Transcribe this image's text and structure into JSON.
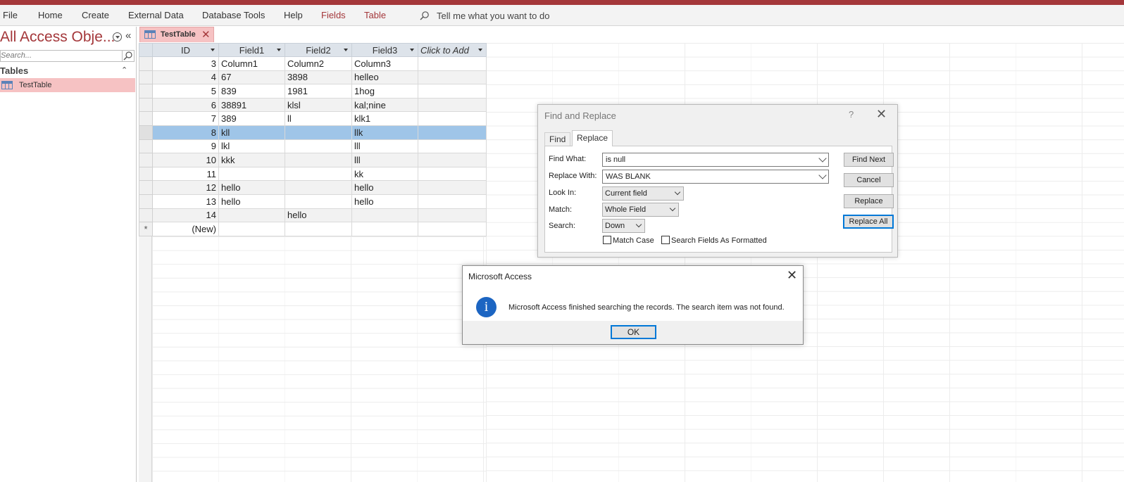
{
  "ribbon": {
    "tabs": [
      "File",
      "Home",
      "Create",
      "External Data",
      "Database Tools",
      "Help"
    ],
    "context_tabs": [
      "Fields",
      "Table"
    ],
    "tell_me": "Tell me what you want to do"
  },
  "nav": {
    "title": "All Access Obje...",
    "collapse_glyph": "«",
    "search_placeholder": "Search...",
    "group_label": "Tables",
    "group_toggle_glyph": "⌃",
    "item_label": "TestTable"
  },
  "doc_tab": {
    "label": "TestTable",
    "close_glyph": "✕"
  },
  "sheet": {
    "columns": [
      "ID",
      "Field1",
      "Field2",
      "Field3",
      "Click to Add"
    ],
    "rows": [
      [
        "3",
        "Column1",
        "Column2",
        "Column3"
      ],
      [
        "4",
        "67",
        "3898",
        "helleo"
      ],
      [
        "5",
        "839",
        "1981",
        "1hog"
      ],
      [
        "6",
        "38891",
        "klsl",
        "kal;nine"
      ],
      [
        "7",
        "389",
        "ll",
        "klk1"
      ],
      [
        "8",
        "kll",
        "",
        "llk"
      ],
      [
        "9",
        "lkl",
        "",
        "lll"
      ],
      [
        "10",
        "kkk",
        "",
        "lll"
      ],
      [
        "11",
        "",
        "",
        "kk"
      ],
      [
        "12",
        "hello",
        "",
        "hello"
      ],
      [
        "13",
        "hello",
        "",
        "hello"
      ],
      [
        "14",
        "",
        "hello",
        ""
      ]
    ],
    "selected_row_index": 5,
    "new_row_marker": "*",
    "new_row_label": "(New)"
  },
  "find_replace": {
    "title": "Find and Replace",
    "help_glyph": "?",
    "close_glyph": "✕",
    "tab_find": "Find",
    "tab_replace": "Replace",
    "find_what_label": "Find What:",
    "find_what_value": "is null",
    "replace_with_label": "Replace With:",
    "replace_with_value": "WAS BLANK",
    "look_in_label": "Look In:",
    "look_in_value": "Current field",
    "match_label": "Match:",
    "match_value": "Whole Field",
    "search_label": "Search:",
    "search_value": "Down",
    "match_case_label": "Match Case",
    "search_formatted_label": "Search Fields As Formatted",
    "btn_find_next": "Find Next",
    "btn_cancel": "Cancel",
    "btn_replace": "Replace",
    "btn_replace_all": "Replace All"
  },
  "message_box": {
    "title": "Microsoft Access",
    "close_glyph": "✕",
    "icon_glyph": "i",
    "text": "Microsoft Access finished searching the records. The search item was not found.",
    "ok_label": "OK"
  },
  "colors": {
    "accent": "#a4373a",
    "selected_row": "#9fc5e8",
    "nav_selected": "#f6c2c3",
    "info_icon": "#1c65c2",
    "default_button_border": "#0078d7"
  }
}
